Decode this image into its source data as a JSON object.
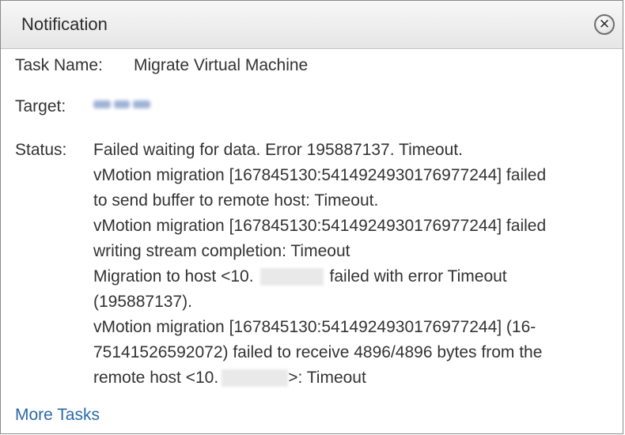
{
  "dialog": {
    "title": "Notification",
    "close_icon": "close-icon"
  },
  "fields": {
    "task_name_label": "Task Name:",
    "task_name_value": "Migrate Virtual Machine",
    "target_label": "Target:",
    "status_label": "Status:"
  },
  "status": {
    "line1": "Failed waiting for data. Error 195887137. Timeout.",
    "line2": "vMotion migration [167845130:5414924930176977244] failed",
    "line3": "to send buffer to remote host: Timeout.",
    "line4": "vMotion migration [167845130:5414924930176977244] failed",
    "line5": "writing stream completion: Timeout",
    "line6_prefix": "Migration to host <10.",
    "line6_suffix": "failed with error Timeout",
    "line7": "(195887137).",
    "line8": "vMotion migration [167845130:5414924930176977244] (16-",
    "line9": "75141526592072) failed to receive 4896/4896 bytes from the",
    "line10_prefix": "remote host <10.",
    "line10_suffix": ">: Timeout"
  },
  "footer": {
    "more_tasks_label": "More Tasks"
  },
  "colors": {
    "link": "#2a6aa6",
    "text": "#333333",
    "titlebar": "#ececec"
  }
}
